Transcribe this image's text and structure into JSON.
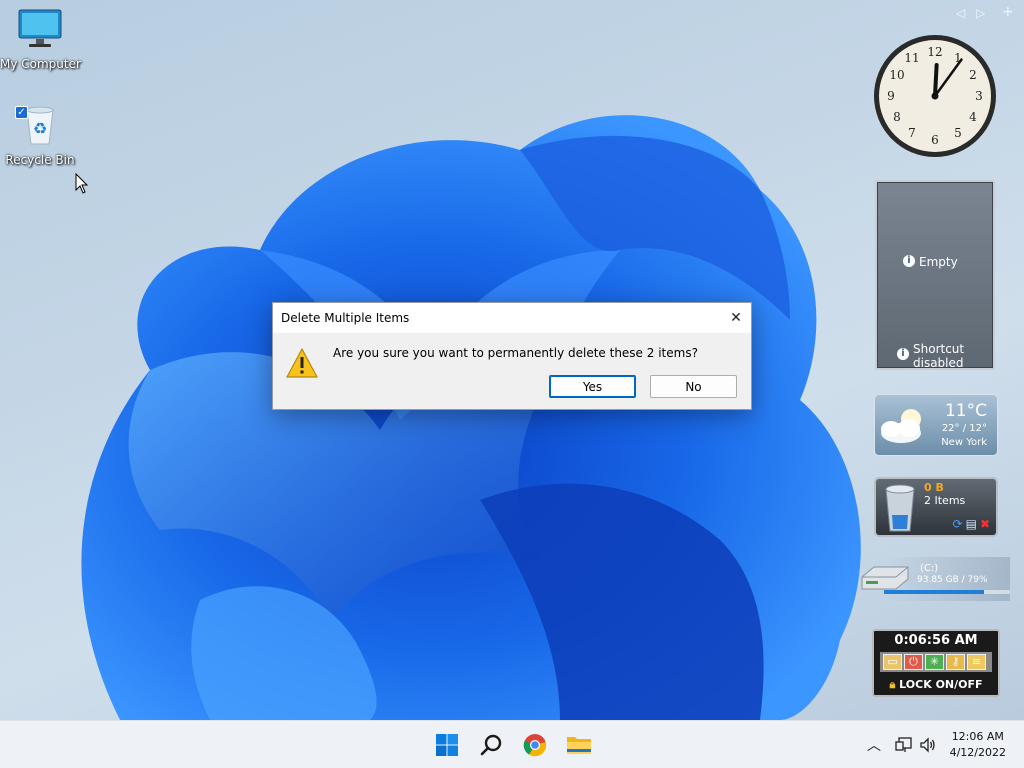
{
  "desktop": {
    "icons": [
      {
        "label": "My Computer"
      },
      {
        "label": "Recycle Bin"
      }
    ]
  },
  "dialog": {
    "title": "Delete Multiple Items",
    "message": "Are you sure you want to permanently delete these 2 items?",
    "yes_label": "Yes",
    "no_label": "No",
    "close_glyph": "✕"
  },
  "gadgets": {
    "gadget_bar": {
      "prev": "◁",
      "next": "▷",
      "add": "+"
    },
    "clock": {
      "hour": 12,
      "minute": 6
    },
    "slideshow": {
      "status": "Empty",
      "shortcut_line1": "Shortcut",
      "shortcut_line2": "disabled"
    },
    "weather": {
      "temp": "11°C",
      "range": "22° / 12°",
      "city": "New York"
    },
    "recycle_bin": {
      "size": "0 B",
      "items": "2 Items"
    },
    "drive": {
      "name": "(C:)",
      "usage": "93.85 GB / 79%",
      "used_fraction": 0.79
    },
    "lock": {
      "time": "0:06:56 AM",
      "label": "LOCK ON/OFF"
    }
  },
  "taskbar": {
    "time": "12:06 AM",
    "date": "4/12/2022"
  },
  "colors": {
    "accent": "#0067c0",
    "warning": "#f7c21c",
    "bin_size": "#f5a623"
  }
}
